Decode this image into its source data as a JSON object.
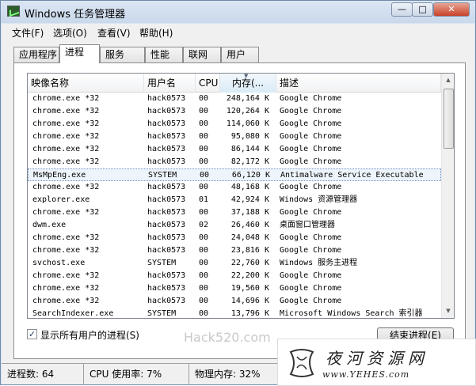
{
  "window": {
    "title": "Windows 任务管理器",
    "controls": {
      "minimize": "—",
      "maximize": "□",
      "close": "✕"
    }
  },
  "menu": [
    "文件(F)",
    "选项(O)",
    "查看(V)",
    "帮助(H)"
  ],
  "tabs": [
    "应用程序",
    "进程",
    "服务",
    "性能",
    "联网",
    "用户"
  ],
  "active_tab": "进程",
  "columns": {
    "name": "映像名称",
    "user": "用户名",
    "cpu": "CPU",
    "mem": "内存(...",
    "desc": "描述"
  },
  "sorted_column": "mem",
  "processes": [
    {
      "name": "chrome.exe *32",
      "user": "hack0573",
      "cpu": "00",
      "mem": "248,164 K",
      "desc": "Google Chrome"
    },
    {
      "name": "chrome.exe *32",
      "user": "hack0573",
      "cpu": "00",
      "mem": "120,264 K",
      "desc": "Google Chrome"
    },
    {
      "name": "chrome.exe *32",
      "user": "hack0573",
      "cpu": "00",
      "mem": "114,060 K",
      "desc": "Google Chrome"
    },
    {
      "name": "chrome.exe *32",
      "user": "hack0573",
      "cpu": "00",
      "mem": "95,080 K",
      "desc": "Google Chrome"
    },
    {
      "name": "chrome.exe *32",
      "user": "hack0573",
      "cpu": "00",
      "mem": "86,144 K",
      "desc": "Google Chrome"
    },
    {
      "name": "chrome.exe *32",
      "user": "hack0573",
      "cpu": "00",
      "mem": "82,172 K",
      "desc": "Google Chrome"
    },
    {
      "name": "MsMpEng.exe",
      "user": "SYSTEM",
      "cpu": "00",
      "mem": "66,120 K",
      "desc": "Antimalware Service Executable",
      "selected": true
    },
    {
      "name": "chrome.exe *32",
      "user": "hack0573",
      "cpu": "00",
      "mem": "48,168 K",
      "desc": "Google Chrome"
    },
    {
      "name": "explorer.exe",
      "user": "hack0573",
      "cpu": "01",
      "mem": "42,924 K",
      "desc": "Windows 资源管理器"
    },
    {
      "name": "chrome.exe *32",
      "user": "hack0573",
      "cpu": "00",
      "mem": "37,188 K",
      "desc": "Google Chrome"
    },
    {
      "name": "dwm.exe",
      "user": "hack0573",
      "cpu": "02",
      "mem": "26,460 K",
      "desc": "桌面窗口管理器"
    },
    {
      "name": "chrome.exe *32",
      "user": "hack0573",
      "cpu": "00",
      "mem": "24,048 K",
      "desc": "Google Chrome"
    },
    {
      "name": "chrome.exe *32",
      "user": "hack0573",
      "cpu": "00",
      "mem": "23,816 K",
      "desc": "Google Chrome"
    },
    {
      "name": "svchost.exe",
      "user": "SYSTEM",
      "cpu": "00",
      "mem": "22,760 K",
      "desc": "Windows 服务主进程"
    },
    {
      "name": "chrome.exe *32",
      "user": "hack0573",
      "cpu": "00",
      "mem": "22,200 K",
      "desc": "Google Chrome"
    },
    {
      "name": "chrome.exe *32",
      "user": "hack0573",
      "cpu": "00",
      "mem": "19,560 K",
      "desc": "Google Chrome"
    },
    {
      "name": "chrome.exe *32",
      "user": "hack0573",
      "cpu": "00",
      "mem": "14,696 K",
      "desc": "Google Chrome"
    },
    {
      "name": "SearchIndexer.exe",
      "user": "SYSTEM",
      "cpu": "00",
      "mem": "13,796 K",
      "desc": "Microsoft Windows Search 索引器"
    }
  ],
  "show_all_users": {
    "label": "显示所有用户的进程(S)",
    "checked": true,
    "checkmark": "✓"
  },
  "watermark": "Hack520.com",
  "end_process_button": "结束进程(E)",
  "status": {
    "processes": "进程数: 64",
    "cpu": "CPU 使用率: 7%",
    "memory": "物理内存: 32%"
  },
  "brand": {
    "name": "夜河资源网",
    "url": "www.YEHES.com",
    "icon": "yehes-logo-icon"
  },
  "colors": {
    "selected_row_border": "#6a8fbf",
    "title_bar": "#dbe6f3",
    "close_button": "#c8422a"
  }
}
